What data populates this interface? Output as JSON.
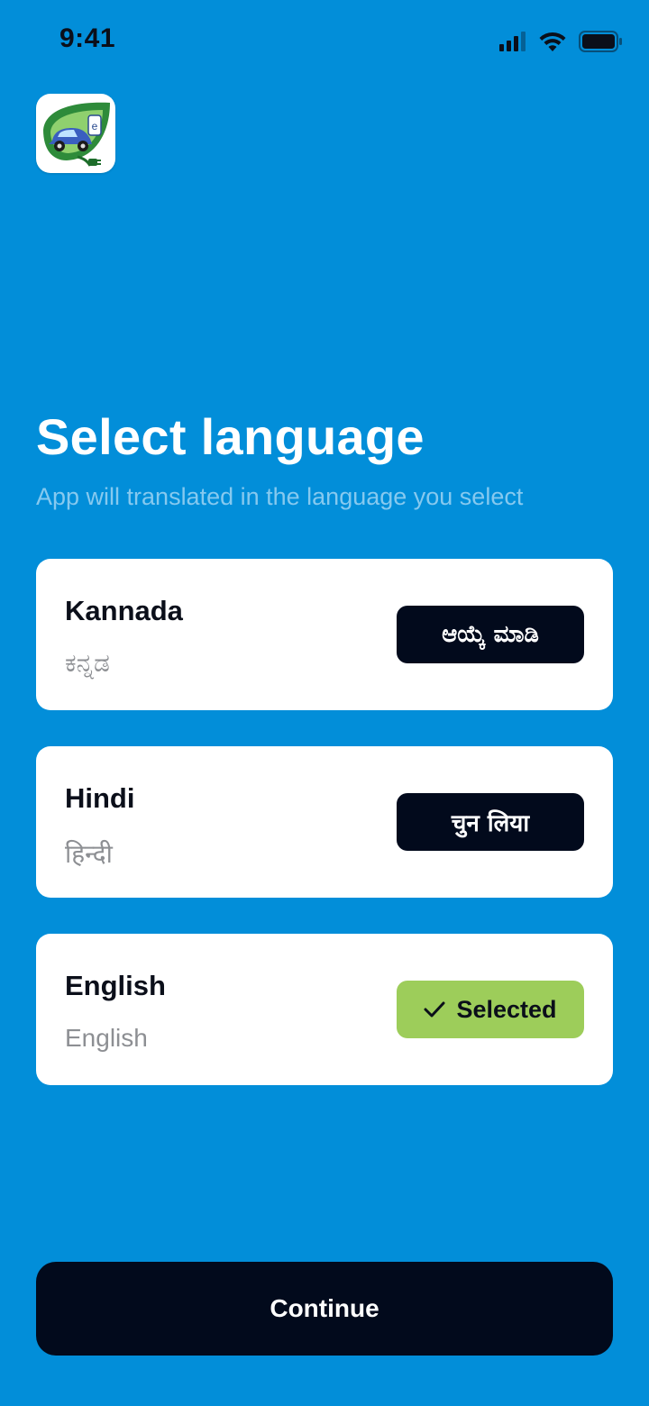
{
  "status_bar": {
    "time": "9:41"
  },
  "header": {
    "logo_icon": "electric-car-leaf-logo",
    "title": "Select language",
    "subtitle": "App will translated in the language you select"
  },
  "languages": [
    {
      "name": "Kannada",
      "native": "ಕನ್ನಡ",
      "button_label": "ಆಯ್ಕೆ ಮಾಡಿ",
      "selected": false
    },
    {
      "name": "Hindi",
      "native": "हिन्दी",
      "button_label": "चुन लिया",
      "selected": false
    },
    {
      "name": "English",
      "native": "English",
      "button_label": "Selected",
      "selected": true
    }
  ],
  "footer": {
    "continue_label": "Continue"
  },
  "colors": {
    "background": "#028ed9",
    "primary_dark": "#020a1c",
    "selected_green": "#9dcd5a",
    "subtitle": "#86c9ef"
  }
}
